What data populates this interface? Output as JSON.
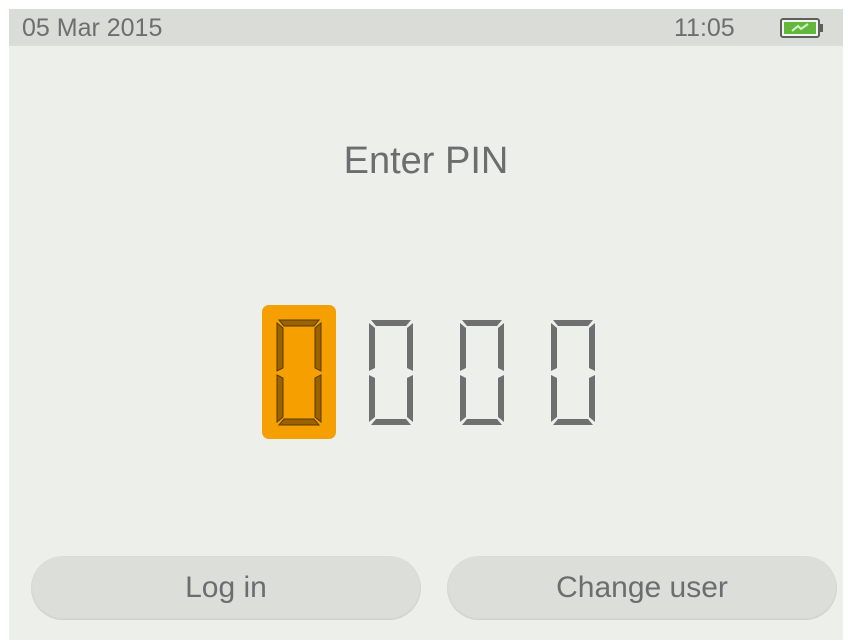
{
  "status_bar": {
    "date": "05 Mar 2015",
    "time": "11:05",
    "battery_icon": "battery-charging-icon",
    "battery_color": "#5fb83a"
  },
  "prompt": {
    "title": "Enter PIN"
  },
  "pin": {
    "digits": [
      "0",
      "0",
      "0",
      "0"
    ],
    "active_index": 0,
    "active_color": "#f5a000"
  },
  "buttons": {
    "login_label": "Log in",
    "change_user_label": "Change user"
  }
}
